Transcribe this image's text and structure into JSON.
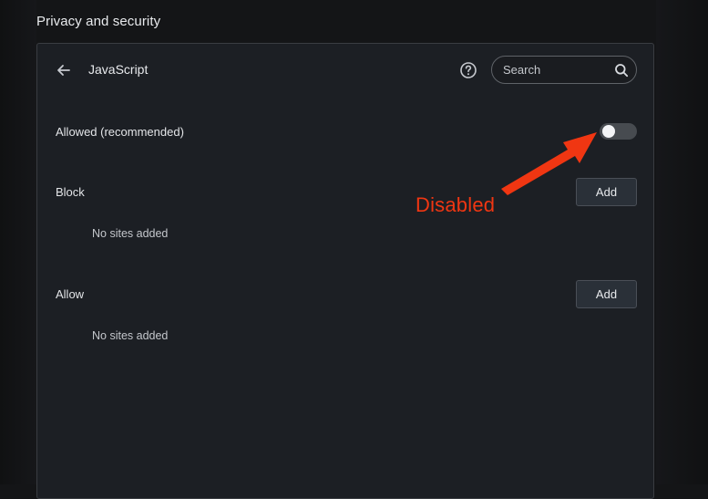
{
  "section": {
    "title": "Privacy and security"
  },
  "panel": {
    "title": "JavaScript",
    "back_icon": "arrow-left-icon",
    "help_icon": "question-circle-icon",
    "search": {
      "placeholder": "Search",
      "value": "",
      "icon": "search-icon"
    },
    "allowed_row": {
      "label": "Allowed (recommended)",
      "toggle_state": "off"
    },
    "block_section": {
      "label": "Block",
      "button_label": "Add",
      "empty_text": "No sites added"
    },
    "allow_section": {
      "label": "Allow",
      "button_label": "Add",
      "empty_text": "No sites added"
    }
  },
  "annotation": {
    "text": "Disabled",
    "color": "#f03612"
  },
  "colors": {
    "page_background": "#141517",
    "panel_background": "#1c1f24",
    "panel_border": "#3a3d42",
    "button_background": "#2a3038",
    "toggle_track": "#474b50"
  }
}
